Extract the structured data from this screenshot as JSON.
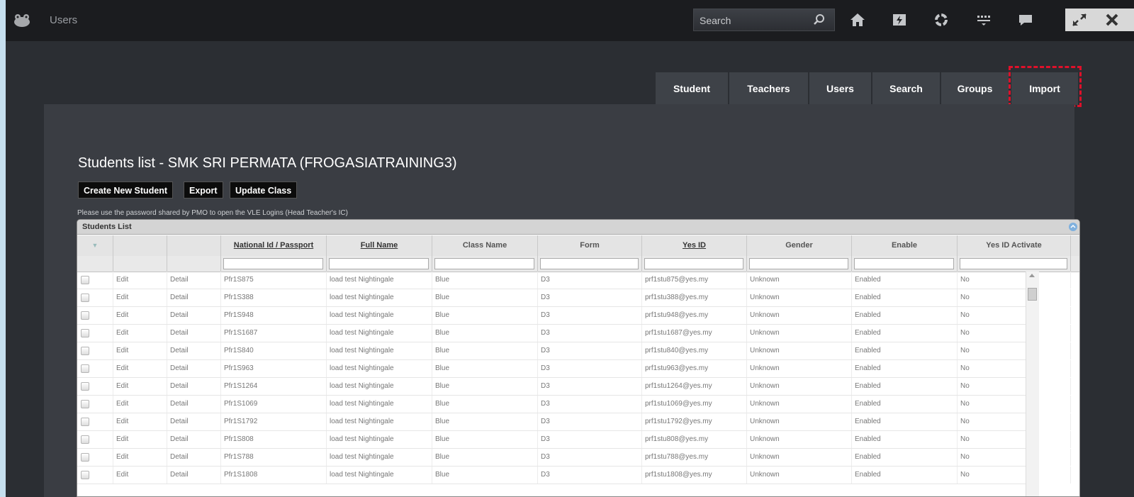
{
  "app": {
    "title": "Users"
  },
  "search": {
    "placeholder": "Search"
  },
  "toolbar_icons": [
    "home-icon",
    "flash-icon",
    "settings-icon",
    "apps-icon",
    "chat-icon"
  ],
  "tabs": [
    "Student",
    "Teachers",
    "Users",
    "Search",
    "Groups",
    "Import"
  ],
  "page": {
    "title": "Students list - SMK SRI PERMATA (FROGASIATRAINING3)",
    "buttons": {
      "create": "Create New Student",
      "export": "Export",
      "update": "Update Class"
    },
    "note": "Please use the password shared by PMO to open the VLE Logins (Head Teacher's IC)"
  },
  "grid": {
    "title": "Students List",
    "columns": [
      "",
      "",
      "",
      "National Id / Passport",
      "Full Name",
      "Class Name",
      "Form",
      "Yes ID",
      "Gender",
      "Enable",
      "Yes ID Activate"
    ],
    "rows": [
      {
        "edit": "Edit",
        "detail": "Detail",
        "nid": "Pfr1S875",
        "name": "load test Nightingale",
        "class": "Blue",
        "form": "D3",
        "yesid": "prf1stu875@yes.my",
        "gender": "Unknown",
        "enable": "Enabled",
        "activate": "No"
      },
      {
        "edit": "Edit",
        "detail": "Detail",
        "nid": "Pfr1S388",
        "name": "load test Nightingale",
        "class": "Blue",
        "form": "D3",
        "yesid": "prf1stu388@yes.my",
        "gender": "Unknown",
        "enable": "Enabled",
        "activate": "No"
      },
      {
        "edit": "Edit",
        "detail": "Detail",
        "nid": "Pfr1S948",
        "name": "load test Nightingale",
        "class": "Blue",
        "form": "D3",
        "yesid": "prf1stu948@yes.my",
        "gender": "Unknown",
        "enable": "Enabled",
        "activate": "No"
      },
      {
        "edit": "Edit",
        "detail": "Detail",
        "nid": "Pfr1S1687",
        "name": "load test Nightingale",
        "class": "Blue",
        "form": "D3",
        "yesid": "prf1stu1687@yes.my",
        "gender": "Unknown",
        "enable": "Enabled",
        "activate": "No"
      },
      {
        "edit": "Edit",
        "detail": "Detail",
        "nid": "Pfr1S840",
        "name": "load test Nightingale",
        "class": "Blue",
        "form": "D3",
        "yesid": "prf1stu840@yes.my",
        "gender": "Unknown",
        "enable": "Enabled",
        "activate": "No"
      },
      {
        "edit": "Edit",
        "detail": "Detail",
        "nid": "Pfr1S963",
        "name": "load test Nightingale",
        "class": "Blue",
        "form": "D3",
        "yesid": "prf1stu963@yes.my",
        "gender": "Unknown",
        "enable": "Enabled",
        "activate": "No"
      },
      {
        "edit": "Edit",
        "detail": "Detail",
        "nid": "Pfr1S1264",
        "name": "load test Nightingale",
        "class": "Blue",
        "form": "D3",
        "yesid": "prf1stu1264@yes.my",
        "gender": "Unknown",
        "enable": "Enabled",
        "activate": "No"
      },
      {
        "edit": "Edit",
        "detail": "Detail",
        "nid": "Pfr1S1069",
        "name": "load test Nightingale",
        "class": "Blue",
        "form": "D3",
        "yesid": "prf1stu1069@yes.my",
        "gender": "Unknown",
        "enable": "Enabled",
        "activate": "No"
      },
      {
        "edit": "Edit",
        "detail": "Detail",
        "nid": "Pfr1S1792",
        "name": "load test Nightingale",
        "class": "Blue",
        "form": "D3",
        "yesid": "prf1stu1792@yes.my",
        "gender": "Unknown",
        "enable": "Enabled",
        "activate": "No"
      },
      {
        "edit": "Edit",
        "detail": "Detail",
        "nid": "Pfr1S808",
        "name": "load test Nightingale",
        "class": "Blue",
        "form": "D3",
        "yesid": "prf1stu808@yes.my",
        "gender": "Unknown",
        "enable": "Enabled",
        "activate": "No"
      },
      {
        "edit": "Edit",
        "detail": "Detail",
        "nid": "Pfr1S788",
        "name": "load test Nightingale",
        "class": "Blue",
        "form": "D3",
        "yesid": "prf1stu788@yes.my",
        "gender": "Unknown",
        "enable": "Enabled",
        "activate": "No"
      },
      {
        "edit": "Edit",
        "detail": "Detail",
        "nid": "Pfr1S1808",
        "name": "load test Nightingale",
        "class": "Blue",
        "form": "D3",
        "yesid": "prf1stu1808@yes.my",
        "gender": "Unknown",
        "enable": "Enabled",
        "activate": "No"
      }
    ]
  },
  "colors": {
    "highlight": "#e0102a",
    "topbar": "#1b1c1f",
    "content": "#2b2e33",
    "panel": "#3a3d43"
  }
}
